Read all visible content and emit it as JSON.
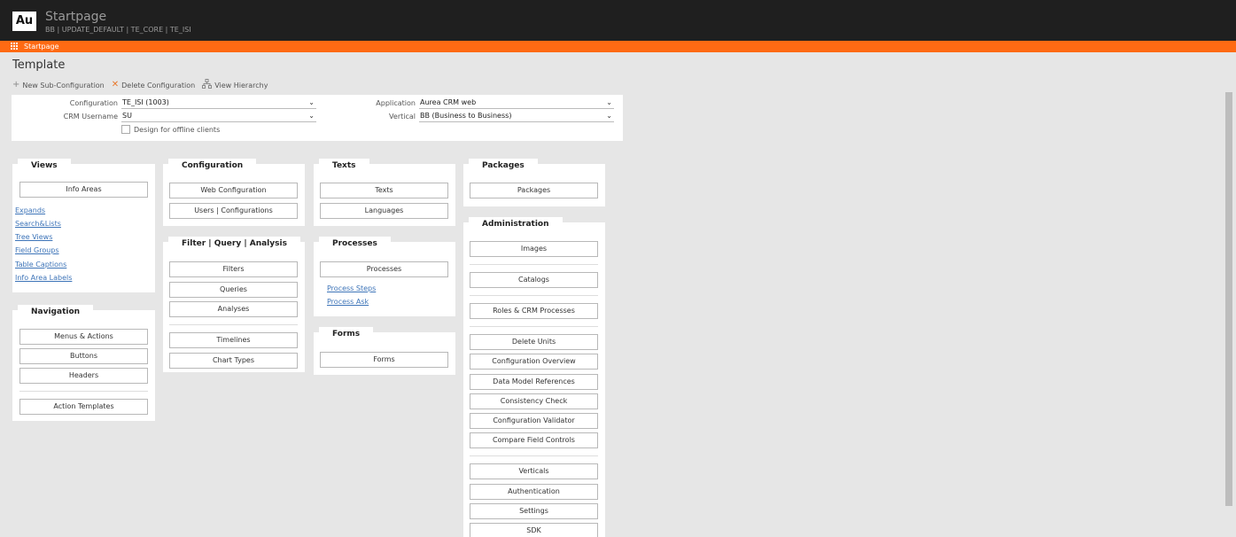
{
  "header": {
    "logo": "Au",
    "title": "Startpage",
    "subtitle": "BB | UPDATE_DEFAULT | TE_CORE | TE_ISI"
  },
  "tabbar": {
    "tab_label": "Startpage"
  },
  "page": {
    "title": "Template"
  },
  "actions": {
    "new_sub": "New Sub-Configuration",
    "delete_config": "Delete Configuration",
    "view_hierarchy": "View Hierarchy"
  },
  "form": {
    "configuration_label": "Configuration",
    "configuration_value": "TE_ISI (1003)",
    "crm_username_label": "CRM Username",
    "crm_username_value": "SU",
    "application_label": "Application",
    "application_value": "Aurea CRM web",
    "vertical_label": "Vertical",
    "vertical_value": "BB (Business to Business)",
    "offline_label": "Design for offline clients"
  },
  "views": {
    "title": "Views",
    "button": "Info Areas",
    "links": [
      "Expands",
      "Search&Lists",
      "Tree Views",
      "Field Groups",
      "Table Captions",
      "Info Area Labels"
    ]
  },
  "navigation": {
    "title": "Navigation",
    "buttons": [
      "Menus & Actions",
      "Buttons",
      "Headers",
      "Action Templates"
    ]
  },
  "configuration": {
    "title": "Configuration",
    "buttons": [
      "Web Configuration",
      "Users | Configurations"
    ]
  },
  "filter": {
    "title": "Filter | Query | Analysis",
    "buttons": [
      "Filters",
      "Queries",
      "Analyses",
      "Timelines",
      "Chart Types"
    ]
  },
  "texts": {
    "title": "Texts",
    "buttons": [
      "Texts",
      "Languages"
    ]
  },
  "processes": {
    "title": "Processes",
    "button": "Processes",
    "links": [
      "Process Steps",
      "Process Ask"
    ]
  },
  "forms": {
    "title": "Forms",
    "button": "Forms"
  },
  "packages": {
    "title": "Packages",
    "button": "Packages"
  },
  "administration": {
    "title": "Administration",
    "buttons": [
      "Images",
      "Catalogs",
      "Roles & CRM Processes",
      "Delete Units",
      "Configuration Overview",
      "Data Model References",
      "Consistency Check",
      "Configuration Validator",
      "Compare Field Controls",
      "Verticals",
      "Authentication",
      "Settings",
      "SDK"
    ]
  },
  "colors": {
    "topbar": "#1f1f1f",
    "accent": "#ff6a13",
    "link": "#3d74b8",
    "delete_icon": "#e8782c"
  },
  "icons": {
    "logo": "au-logo-icon",
    "tab": "grid-icon",
    "new": "plus-icon",
    "delete": "x-icon",
    "hierarchy": "hierarchy-icon",
    "dropdown": "chevron-down-icon"
  }
}
